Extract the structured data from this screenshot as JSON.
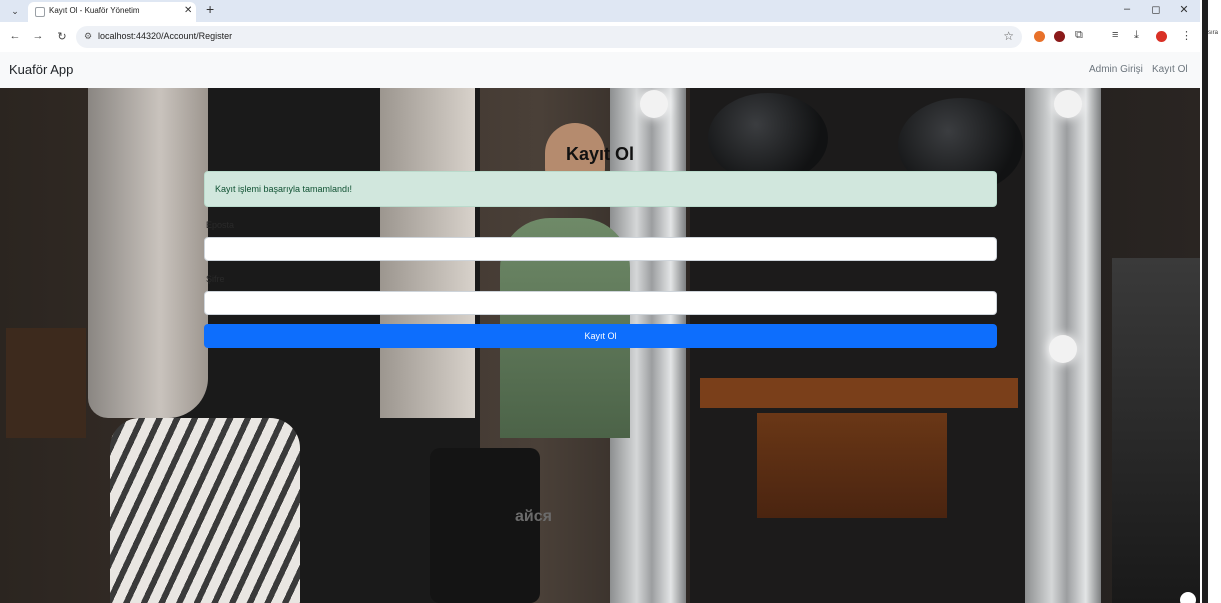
{
  "browser": {
    "tab_title": "Kayıt Ol - Kuaför Yönetim",
    "url": "localhost:44320/Account/Register",
    "side_text": "sıra"
  },
  "navbar": {
    "brand": "Kuaför App",
    "links": [
      "Admin Girişi",
      "Kayıt Ol"
    ]
  },
  "background": {
    "chair_text": "айся"
  },
  "form": {
    "title": "Kayıt Ol",
    "alert": "Kayıt işlemi başarıyla tamamlandı!",
    "fields": [
      {
        "label": "Eposta",
        "value": ""
      },
      {
        "label": "Şifre",
        "value": ""
      }
    ],
    "submit_label": "Kayıt Ol"
  },
  "colors": {
    "primary": "#0d6efd",
    "alert_bg": "#d1e7dd",
    "alert_text": "#0f5132",
    "navbar_bg": "#f8f9fa"
  },
  "icons": [
    "tab-list-icon",
    "close-icon",
    "plus-icon",
    "back-icon",
    "forward-icon",
    "reload-icon",
    "site-info-icon",
    "star-icon",
    "minimize-icon",
    "maximize-icon"
  ]
}
